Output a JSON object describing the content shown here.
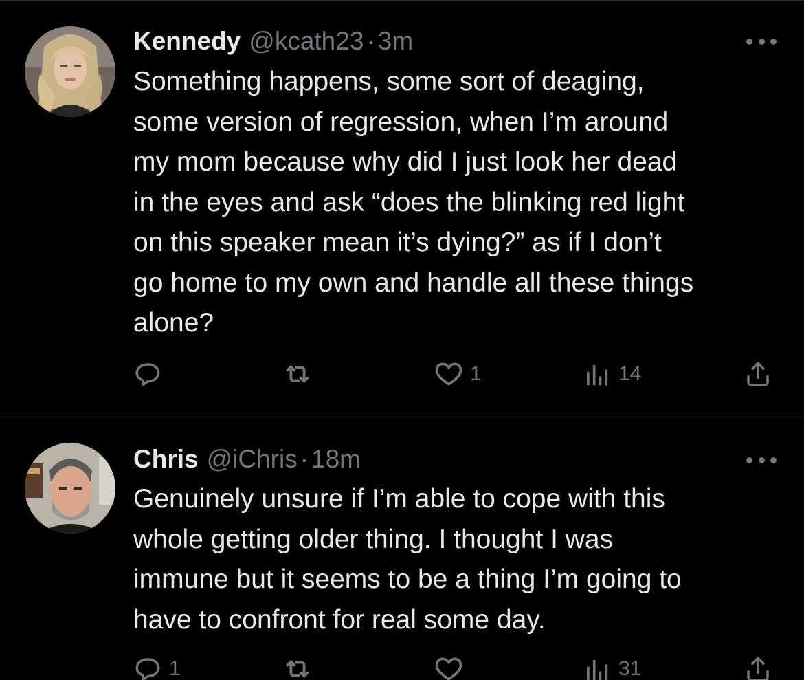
{
  "tweets": [
    {
      "name": "Kennedy",
      "handle": "@kcath23",
      "separator": "·",
      "time": "3m",
      "lines": [
        "Something happens, some sort of deaging,",
        "some version of regression, when I’m around",
        "my mom because why did I just look her dead",
        "in the eyes and ask “does the blinking red light",
        "on this speaker mean it’s dying?” as if I don’t",
        "go home to my own and handle all these things",
        "alone?"
      ],
      "replies": "",
      "retweets": "",
      "likes": "1",
      "views": "14"
    },
    {
      "name": "Chris",
      "handle": "@iChris",
      "separator": "·",
      "time": "18m",
      "lines": [
        "Genuinely unsure if I’m able to cope with this",
        "whole getting older thing. I thought I was",
        "immune but it seems to be a thing I’m going to",
        "have to confront for real some day."
      ],
      "replies": "1",
      "retweets": "",
      "likes": "",
      "views": "31"
    }
  ],
  "icons": {
    "reply": "reply-icon",
    "retweet": "retweet-icon",
    "like": "heart-icon",
    "views": "views-chart-icon",
    "share": "share-icon",
    "more": "more-icon"
  },
  "colors": {
    "background": "#000000",
    "text": "#e7e9ea",
    "secondary": "#71767b",
    "divider": "#2f3336"
  }
}
